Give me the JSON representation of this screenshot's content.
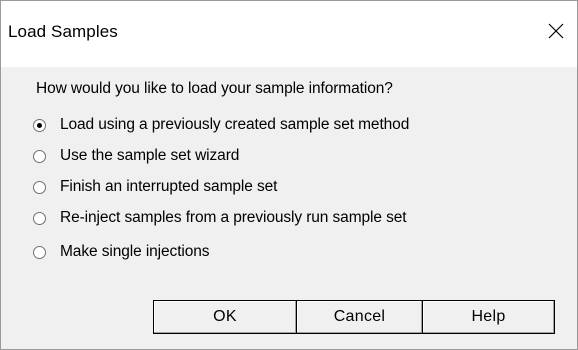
{
  "window": {
    "title": "Load Samples",
    "close_icon": "close-icon"
  },
  "prompt": "How would you like to load your sample information?",
  "options": [
    {
      "label": "Load using a previously created sample set method",
      "selected": true
    },
    {
      "label": "Use the sample set wizard",
      "selected": false
    },
    {
      "label": "Finish an interrupted sample set",
      "selected": false
    },
    {
      "label": "Re-inject samples from a previously run sample set",
      "selected": false
    },
    {
      "label": "Make single injections",
      "selected": false
    }
  ],
  "buttons": {
    "ok": "OK",
    "cancel": "Cancel",
    "help": "Help"
  }
}
